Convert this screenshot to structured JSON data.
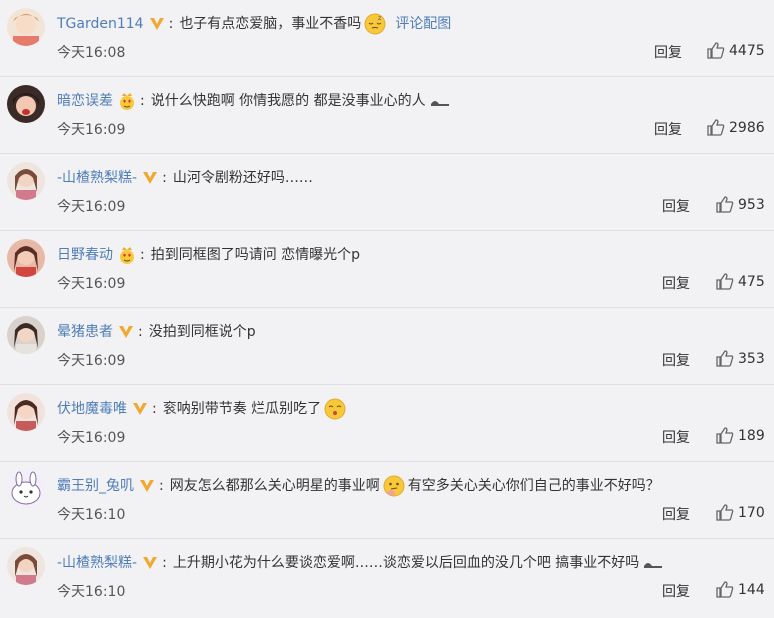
{
  "comments": [
    {
      "username": "TGarden114",
      "badge": "verified-v",
      "text": "也子有点恋爱脑，事业不香吗",
      "emoji": "sleepy-face-emoji",
      "link": "评论配图",
      "time": "今天16:08",
      "reply": "回复",
      "likes": "4475",
      "avatar_color": "#e8c9b7"
    },
    {
      "username": "暗恋误差",
      "badge": "crown-heart-eyes",
      "text": "说什么快跑啊 你情我愿的 都是没事业心的人",
      "trail": "slipper-emoji",
      "time": "今天16:09",
      "reply": "回复",
      "likes": "2986",
      "avatar_color": "#d76d68"
    },
    {
      "username": "-山楂熟梨糕-",
      "badge": "verified-v",
      "text": "山河令剧粉还好吗……",
      "time": "今天16:09",
      "reply": "回复",
      "likes": "953",
      "avatar_color": "#c9a48f"
    },
    {
      "username": "日野春动",
      "badge": "crown-heart-eyes",
      "text": "拍到同框图了吗请问 恋情曝光个p",
      "time": "今天16:09",
      "reply": "回复",
      "likes": "475",
      "avatar_color": "#c66a5f"
    },
    {
      "username": "晕猪患者",
      "badge": "verified-v",
      "text": "没拍到同框说个p",
      "time": "今天16:09",
      "reply": "回复",
      "likes": "353",
      "avatar_color": "#b9a89b"
    },
    {
      "username": "伏地魔毒唯",
      "badge": "verified-v",
      "text": "衮呐别带节奏 烂瓜别吃了",
      "emoji": "kissing-face-emoji",
      "time": "今天16:09",
      "reply": "回复",
      "likes": "189",
      "avatar_color": "#c99383"
    },
    {
      "username": "霸王别_兔叽",
      "badge": "verified-v",
      "text": "网友怎么都那么关心明星的事业啊",
      "emoji": "thinking-face-emoji",
      "text2": "有空多关心关心你们自己的事业不好吗？",
      "time": "今天16:10",
      "reply": "回复",
      "likes": "170",
      "avatar_color": "#a79bc5"
    },
    {
      "username": "-山楂熟梨糕-",
      "badge": "verified-v",
      "text": "上升期小花为什么要谈恋爱啊……谈恋爱以后回血的没几个吧 搞事业不好吗",
      "trail": "slipper-emoji",
      "time": "今天16:10",
      "reply": "回复",
      "likes": "144",
      "avatar_color": "#c9a48f"
    }
  ],
  "colors": {
    "username": "#4f7db8",
    "badge_v": "#f0a830",
    "background": "#f2f2f5"
  }
}
